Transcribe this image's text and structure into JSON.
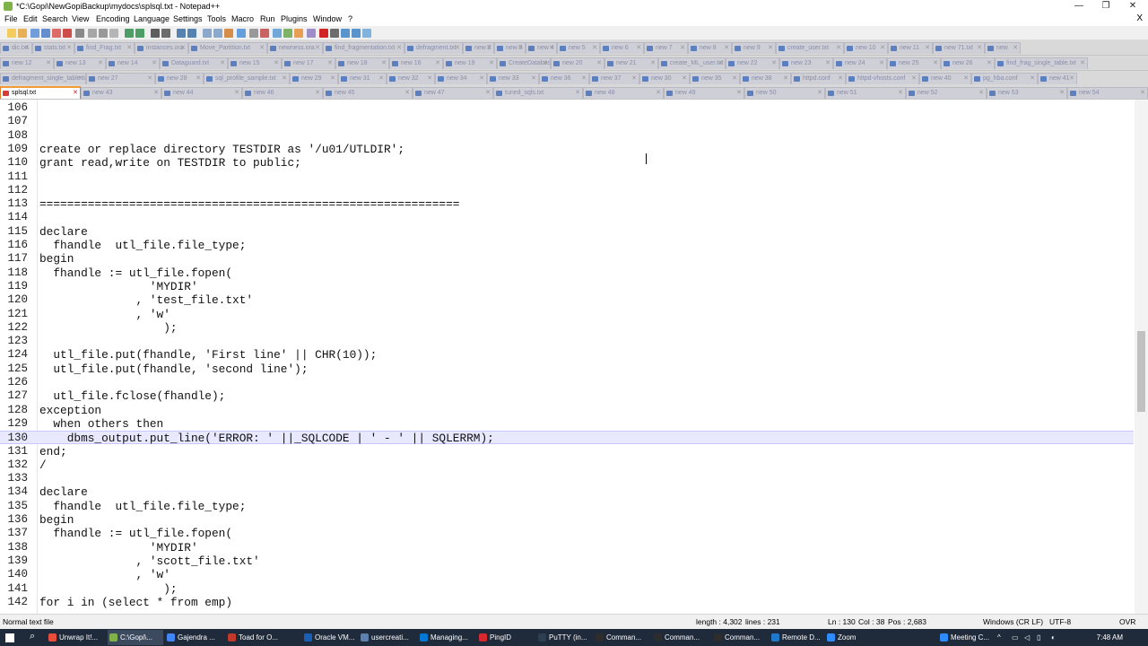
{
  "window": {
    "title": "*C:\\Gopi\\NewGopiBackup\\mydocs\\splsql.txt - Notepad++",
    "minimize": "—",
    "restore": "❐",
    "close": "✕"
  },
  "menu": [
    "File",
    "Edit",
    "Search",
    "View",
    "Encoding",
    "Language",
    "Settings",
    "Tools",
    "Macro",
    "Run",
    "Plugins",
    "Window",
    "?"
  ],
  "menu_close": "X",
  "toolbar_icons": [
    "new-file-icon",
    "open-file-icon",
    "save-icon",
    "save-all-icon",
    "close-icon",
    "close-all-icon",
    "print-icon",
    "cut-icon",
    "copy-icon",
    "paste-icon",
    "undo-icon",
    "redo-icon",
    "find-icon",
    "replace-icon",
    "zoom-in-icon",
    "zoom-out-icon",
    "sync-v-icon",
    "sync-h-icon",
    "word-wrap-icon",
    "show-all-icon",
    "indent-guide-icon",
    "udl-icon",
    "doc-map-icon",
    "function-list-icon",
    "folder-workspace-icon",
    "monitor-icon",
    "record-macro-icon",
    "stop-macro-icon",
    "play-macro-icon",
    "run-macro-icon",
    "save-macro-icon"
  ],
  "tabs_row1": [
    "dic.txt",
    "stats.txt",
    "find_Frag.txt",
    "instances.ora",
    "Move_Partition.txt",
    "newness.ora",
    "find_fragmentation.txt",
    "defragment.txt",
    "new 2",
    "new 3",
    "new 4",
    "new 5",
    "new 6",
    "new 7",
    "new 8",
    "new 9",
    "create_user.txt",
    "new 10",
    "new 11",
    "new 71.txt",
    "new"
  ],
  "tabs_row2": [
    "new 12",
    "new 13",
    "new 14",
    "Dataguard.txt",
    "new 15",
    "new 17",
    "new 18",
    "new 16",
    "new 19",
    "CreateDatabase.sh",
    "new 20",
    "new 21",
    "create_ML_user.txt",
    "new 22",
    "new 23",
    "new 24",
    "new 25",
    "new 26",
    "find_frag_single_table.txt"
  ],
  "tabs_row3": [
    "defragment_single_table.txt",
    "new 27",
    "new 28",
    "sql_profile_sample.txt",
    "new 29",
    "new 31",
    "new 32",
    "new 34",
    "new 33",
    "new 36",
    "new 37",
    "new 30",
    "new 35",
    "new 38",
    "httpd.conf",
    "httpd-vhosts.conf",
    "new 40",
    "pg_hba.conf",
    "new 41"
  ],
  "tabs_row4": [
    "splsql.txt",
    "new 43",
    "new 44",
    "new 46",
    "new 45",
    "new 47",
    "tuned_sqls.txt",
    "new 48",
    "new 49",
    "new 50",
    "new 51",
    "new 52",
    "new 53",
    "new 54"
  ],
  "active_tab": "splsql.txt",
  "lines": [
    {
      "n": "106",
      "text": ""
    },
    {
      "n": "107",
      "text": ""
    },
    {
      "n": "108",
      "text": ""
    },
    {
      "n": "109",
      "text": "create or replace directory TESTDIR as '/u01/UTLDIR';"
    },
    {
      "n": "110",
      "text": "grant read,write on TESTDIR to public;"
    },
    {
      "n": "111",
      "text": ""
    },
    {
      "n": "112",
      "text": ""
    },
    {
      "n": "113",
      "text": "============================================================="
    },
    {
      "n": "114",
      "text": ""
    },
    {
      "n": "115",
      "text": "declare"
    },
    {
      "n": "116",
      "text": "  fhandle  utl_file.file_type;"
    },
    {
      "n": "117",
      "text": "begin"
    },
    {
      "n": "118",
      "text": "  fhandle := utl_file.fopen("
    },
    {
      "n": "119",
      "text": "                'MYDIR'"
    },
    {
      "n": "120",
      "text": "              , 'test_file.txt'"
    },
    {
      "n": "121",
      "text": "              , 'w'"
    },
    {
      "n": "122",
      "text": "                  );"
    },
    {
      "n": "123",
      "text": ""
    },
    {
      "n": "124",
      "text": "  utl_file.put(fhandle, 'First line' || CHR(10));"
    },
    {
      "n": "125",
      "text": "  utl_file.put(fhandle, 'second line');"
    },
    {
      "n": "126",
      "text": ""
    },
    {
      "n": "127",
      "text": "  utl_file.fclose(fhandle);"
    },
    {
      "n": "128",
      "text": "exception"
    },
    {
      "n": "129",
      "text": "  when others then"
    },
    {
      "n": "130",
      "text": "    dbms_output.put_line('ERROR: ' ||_SQLCODE | ' - ' || SQLERRM);"
    },
    {
      "n": "131",
      "text": "end;"
    },
    {
      "n": "132",
      "text": "/"
    },
    {
      "n": "133",
      "text": ""
    },
    {
      "n": "134",
      "text": "declare"
    },
    {
      "n": "135",
      "text": "  fhandle  utl_file.file_type;"
    },
    {
      "n": "136",
      "text": "begin"
    },
    {
      "n": "137",
      "text": "  fhandle := utl_file.fopen("
    },
    {
      "n": "138",
      "text": "                'MYDIR'"
    },
    {
      "n": "139",
      "text": "              , 'scott_file.txt'"
    },
    {
      "n": "140",
      "text": "              , 'w'"
    },
    {
      "n": "141",
      "text": "                  );"
    },
    {
      "n": "142",
      "text": "for i in (select * from emp)"
    }
  ],
  "current_line": "130",
  "status": {
    "file_type": "Normal text file",
    "length": "length : 4,302",
    "lines": "lines : 231",
    "ln": "Ln : 130",
    "col": "Col : 38",
    "pos": "Pos : 2,683",
    "eol": "Windows (CR LF)",
    "encoding": "UTF-8",
    "mode": "OVR"
  },
  "taskbar": {
    "apps": [
      "Unwrap It!...",
      "C:\\Gopi\\...",
      "Gajendra ...",
      "Toad for O...",
      "Oracle VM...",
      "usercreati...",
      "Managing...",
      "PingID",
      "PuTTY (in...",
      "Comman...",
      "Comman...",
      "Comman...",
      "Remote D...",
      "Zoom",
      "Meeting C..."
    ],
    "clock": "7:48 AM"
  },
  "colors": {
    "active_tab_accent": "#f39c37",
    "current_line_bg": "#e8e8ff",
    "taskbar_bg": "#1f2a3a"
  }
}
